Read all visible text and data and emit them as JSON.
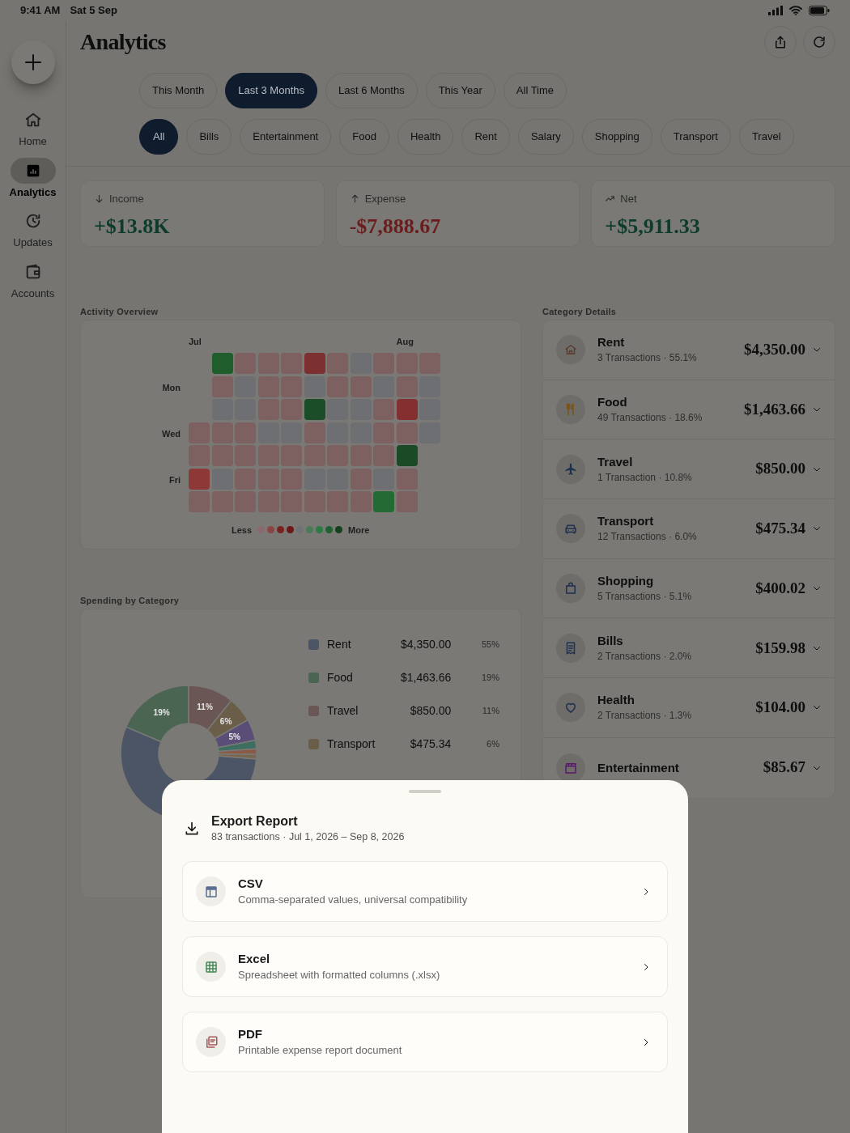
{
  "status_bar": {
    "time": "9:41 AM",
    "date": "Sat 5 Sep"
  },
  "sidebar": {
    "items": [
      {
        "label": "Home",
        "selected": false
      },
      {
        "label": "Analytics",
        "selected": true
      },
      {
        "label": "Updates",
        "selected": false
      },
      {
        "label": "Accounts",
        "selected": false
      }
    ]
  },
  "header": {
    "title": "Analytics"
  },
  "periods": [
    {
      "label": "This Month",
      "selected": false
    },
    {
      "label": "Last 3 Months",
      "selected": true
    },
    {
      "label": "Last 6 Months",
      "selected": false
    },
    {
      "label": "This Year",
      "selected": false
    },
    {
      "label": "All Time",
      "selected": false
    }
  ],
  "category_filters": [
    {
      "label": "All",
      "selected": true
    },
    {
      "label": "Bills",
      "selected": false
    },
    {
      "label": "Entertainment",
      "selected": false
    },
    {
      "label": "Food",
      "selected": false
    },
    {
      "label": "Health",
      "selected": false
    },
    {
      "label": "Rent",
      "selected": false
    },
    {
      "label": "Salary",
      "selected": false
    },
    {
      "label": "Shopping",
      "selected": false
    },
    {
      "label": "Transport",
      "selected": false
    },
    {
      "label": "Travel",
      "selected": false
    }
  ],
  "summary": [
    {
      "kind": "income",
      "label": "Income",
      "value": "+$13.8K"
    },
    {
      "kind": "expense",
      "label": "Expense",
      "value": "-$7,888.67"
    },
    {
      "kind": "net",
      "label": "Net",
      "value": "+$5,911.33"
    }
  ],
  "activity": {
    "title": "Activity Overview",
    "months": [
      "Jul",
      "Aug"
    ],
    "days": [
      "Mon",
      "Wed",
      "Fri"
    ],
    "rows": [
      {
        "cells": [
          null,
          {
            "color": "#1f5e2c"
          },
          {
            "color": "#7d6060"
          },
          {
            "color": "#7d6060"
          },
          {
            "color": "#7d6060"
          },
          {
            "color": "#7d3030"
          },
          {
            "color": "#7d6060"
          },
          {
            "color": "#6e6f72"
          },
          {
            "color": "#7d6060"
          },
          {
            "color": "#7d6060"
          },
          {
            "color": "#7d6060"
          }
        ]
      },
      {
        "cells": [
          null,
          {
            "color": "#7d6060"
          },
          {
            "color": "#6e6f72"
          },
          {
            "color": "#7d6060"
          },
          {
            "color": "#7d6060"
          },
          {
            "color": "#6e6f72"
          },
          {
            "color": "#7d6060"
          },
          {
            "color": "#7d6060"
          },
          {
            "color": "#6e6f72"
          },
          {
            "color": "#7d6060"
          },
          {
            "color": "#6e6f72"
          }
        ]
      },
      {
        "cells": [
          null,
          {
            "color": "#6e6f72"
          },
          {
            "color": "#6e6f72"
          },
          {
            "color": "#7d6060"
          },
          {
            "color": "#7d6060"
          },
          {
            "color": "#1a4d28"
          },
          {
            "color": "#6e6f72"
          },
          {
            "color": "#6e6f72"
          },
          {
            "color": "#7d6060"
          },
          {
            "color": "#843030"
          },
          {
            "color": "#6e6f72"
          }
        ]
      },
      {
        "cells": [
          {
            "color": "#7d6060"
          },
          {
            "color": "#7d6060"
          },
          {
            "color": "#7d6060"
          },
          {
            "color": "#6e6f72"
          },
          {
            "color": "#6e6f72"
          },
          {
            "color": "#7d6060"
          },
          {
            "color": "#6e6f72"
          },
          {
            "color": "#6e6f72"
          },
          {
            "color": "#7d6060"
          },
          {
            "color": "#7d6060"
          },
          {
            "color": "#6e6f72"
          }
        ]
      },
      {
        "cells": [
          {
            "color": "#7d6060"
          },
          {
            "color": "#7d6060"
          },
          {
            "color": "#7d6060"
          },
          {
            "color": "#7d6060"
          },
          {
            "color": "#7d6060"
          },
          {
            "color": "#7d6060"
          },
          {
            "color": "#7d6060"
          },
          {
            "color": "#7d6060"
          },
          {
            "color": "#7d6060"
          },
          {
            "color": "#1a4a26"
          },
          null
        ]
      },
      {
        "cells": [
          {
            "color": "#8e3838"
          },
          {
            "color": "#6e6f72"
          },
          {
            "color": "#7d6060"
          },
          {
            "color": "#7d6060"
          },
          {
            "color": "#7d6060"
          },
          {
            "color": "#6e6f72"
          },
          {
            "color": "#6e6f72"
          },
          {
            "color": "#7d6060"
          },
          {
            "color": "#6e6f72"
          },
          {
            "color": "#7d6060"
          },
          null
        ]
      },
      {
        "cells": [
          {
            "color": "#7d6060"
          },
          {
            "color": "#7d6060"
          },
          {
            "color": "#7d6060"
          },
          {
            "color": "#7d6060"
          },
          {
            "color": "#7d6060"
          },
          {
            "color": "#7d6060"
          },
          {
            "color": "#7d6060"
          },
          {
            "color": "#7d6060"
          },
          {
            "color": "#246a34"
          },
          {
            "color": "#7d6060"
          },
          null
        ]
      }
    ],
    "legend": {
      "less": "Less",
      "more": "More",
      "swatches": [
        {
          "color": "#8a6a6e"
        },
        {
          "color": "#8a4444"
        },
        {
          "color": "#7a2020"
        },
        {
          "color": "#6a1818"
        },
        {
          "color": "#707276"
        },
        {
          "color": "#4a7a58"
        },
        {
          "color": "#2e7a44"
        },
        {
          "color": "#1e6030"
        },
        {
          "color": "#14401e"
        }
      ]
    }
  },
  "category_details": {
    "title": "Category Details",
    "items": [
      {
        "name": "Rent",
        "subtitle": "3 Transactions · 55.1%",
        "amount": "$4,350.00",
        "color": "#5a3e30"
      },
      {
        "name": "Food",
        "subtitle": "49 Transactions · 18.6%",
        "amount": "$1,463.66",
        "color": "#7a5418"
      },
      {
        "name": "Travel",
        "subtitle": "1 Transaction · 10.8%",
        "amount": "$850.00",
        "color": "#1f2f4e"
      },
      {
        "name": "Transport",
        "subtitle": "12 Transactions · 6.0%",
        "amount": "$475.34",
        "color": "#1f2f4e"
      },
      {
        "name": "Shopping",
        "subtitle": "5 Transactions · 5.1%",
        "amount": "$400.02",
        "color": "#1f2f4e"
      },
      {
        "name": "Bills",
        "subtitle": "2 Transactions · 2.0%",
        "amount": "$159.98",
        "color": "#1f2f4e"
      },
      {
        "name": "Health",
        "subtitle": "2 Transactions · 1.3%",
        "amount": "$104.00",
        "color": "#1f2f4e"
      },
      {
        "name": "Entertainment",
        "amount": "$85.67",
        "color": "#5a1a6a"
      }
    ]
  },
  "spending": {
    "title": "Spending by Category",
    "legend": [
      {
        "name": "Rent",
        "amount": "$4,350.00",
        "percent": "55%",
        "color": "#4b5566"
      },
      {
        "name": "Food",
        "amount": "$1,463.66",
        "percent": "19%",
        "color": "#4a6652"
      },
      {
        "name": "Travel",
        "amount": "$850.00",
        "percent": "11%",
        "color": "#6b5656"
      },
      {
        "name": "Transport",
        "amount": "$475.34",
        "percent": "6%",
        "color": "#6a5e48"
      }
    ],
    "chart_data": {
      "type": "donut",
      "series": [
        {
          "values": [
            55.1,
            18.6,
            10.8,
            6.0,
            5.1,
            2.0,
            1.3,
            1.1
          ]
        }
      ],
      "colors": [
        "#4b5566",
        "#4a6652",
        "#6b5656",
        "#6a5e48",
        "#5a4e78",
        "#3e6e60",
        "#8a5a46",
        "#7a6650"
      ],
      "value_labels": [
        null,
        "19%",
        "11%",
        "6%",
        "5%",
        null,
        null,
        null
      ]
    }
  },
  "export_sheet": {
    "title": "Export Report",
    "subtitle": "83 transactions · Jul 1, 2026 – Sep 8, 2026",
    "options": [
      {
        "name": "CSV",
        "description": "Comma-separated values, universal compatibility",
        "color": "#5a6f90"
      },
      {
        "name": "Excel",
        "description": "Spreadsheet with formatted columns (.xlsx)",
        "color": "#4a8a5a"
      },
      {
        "name": "PDF",
        "description": "Printable expense report document",
        "color": "#a05a5a"
      }
    ]
  }
}
